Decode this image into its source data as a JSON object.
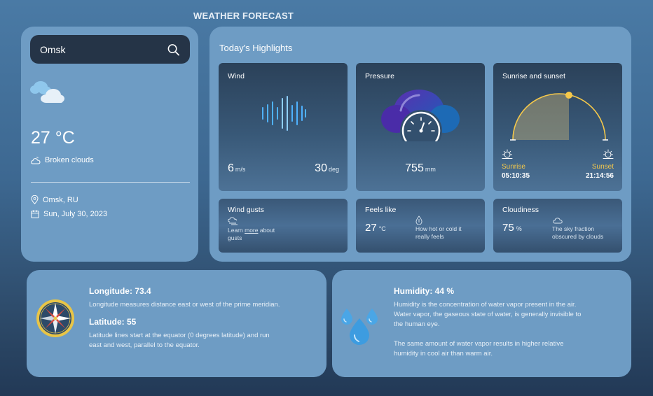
{
  "header": {
    "title": "WEATHER FORECAST"
  },
  "search": {
    "value": "Omsk",
    "placeholder": "Search city"
  },
  "current": {
    "temperature": "27 °C",
    "condition": "Broken clouds",
    "location": "Omsk, RU",
    "date": "Sun, July 30, 2023"
  },
  "highlights": {
    "title": "Today's Highlights",
    "wind": {
      "label": "Wind",
      "speed": "6",
      "speed_unit": "m/s",
      "direction": "30",
      "direction_unit": "deg"
    },
    "pressure": {
      "label": "Pressure",
      "value": "755",
      "unit": "mm"
    },
    "sun": {
      "label": "Sunrise and sunset",
      "sunrise_label": "Sunrise",
      "sunrise_time": "05:10:35",
      "sunset_label": "Sunset",
      "sunset_time": "21:14:56"
    },
    "gusts": {
      "label": "Wind gusts",
      "text_before": "Learn ",
      "link": "more",
      "text_after": " about",
      "text_line2": "gusts"
    },
    "feels": {
      "label": "Feels like",
      "value": "27",
      "unit": "°C",
      "desc_line1": "How hot or cold it",
      "desc_line2": "really feels"
    },
    "cloudiness": {
      "label": "Cloudiness",
      "value": "75",
      "unit": "%",
      "desc_line1": "The sky fraction",
      "desc_line2": "obscured by clouds"
    }
  },
  "coords": {
    "longitude_title": "Longitude: 73.4",
    "longitude_text": "Longitude measures distance east or west of the prime meridian.",
    "latitude_title": "Latitude: 55",
    "latitude_line1": "Latitude lines start at the equator (0 degrees latitude) and run",
    "latitude_line2": "east and west, parallel to the equator."
  },
  "humidity": {
    "title": "Humidity: 44 %",
    "line1": "Humidity is the concentration of water vapor present in the air.",
    "line2": "Water vapor, the gaseous state of water, is generally invisible to",
    "line3": "the human eye.",
    "line4": "The same amount of water vapor results in higher relative",
    "line5": "humidity in cool air than warm air."
  },
  "colors": {
    "panel": "#6e9cc4",
    "search_bg": "#253447",
    "sun_accent": "#f5c84a"
  },
  "icons": [
    "search-icon",
    "broken-clouds-icon",
    "cloud-outline-icon",
    "location-pin-icon",
    "calendar-icon",
    "sound-wave-icon",
    "pressure-cloud-icon",
    "sunrise-icon",
    "sunset-icon",
    "wind-cloud-icon",
    "thermometer-drop-icon",
    "cloud-icon",
    "compass-icon",
    "water-drops-icon"
  ]
}
